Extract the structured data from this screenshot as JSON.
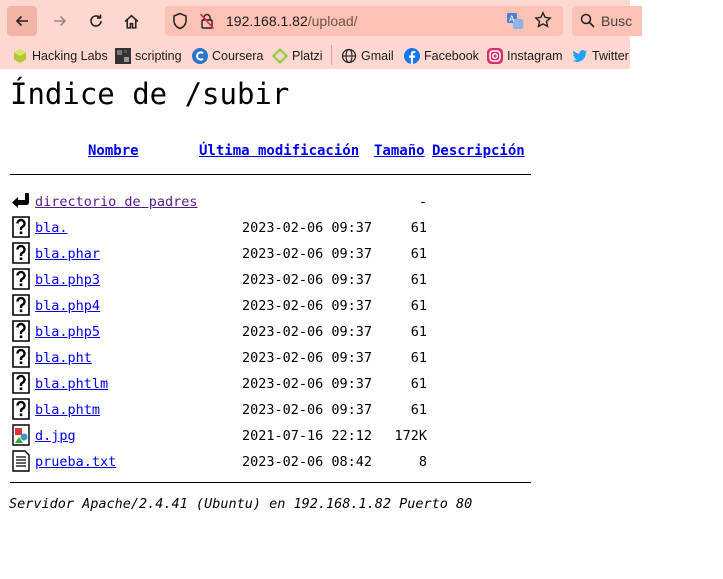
{
  "browser": {
    "url_host": "192.168.1.82",
    "url_path": "/upload/",
    "search_placeholder": "Busc",
    "bookmarks": [
      {
        "label": "Hacking Labs",
        "icon": "hacking-labs-icon"
      },
      {
        "label": "scripting",
        "icon": "scripting-icon"
      },
      {
        "label": "Coursera",
        "icon": "coursera-icon"
      },
      {
        "label": "Platzi",
        "icon": "platzi-icon"
      },
      {
        "label": "Gmail",
        "icon": "globe-icon"
      },
      {
        "label": "Facebook",
        "icon": "facebook-icon"
      },
      {
        "label": "Instagram",
        "icon": "instagram-icon"
      },
      {
        "label": "Twitter",
        "icon": "twitter-icon"
      }
    ]
  },
  "listing": {
    "title": "Índice de /subir",
    "headers": {
      "name": "Nombre",
      "modified": "Última modificación",
      "size": "Tamaño",
      "description": "Descripción"
    },
    "parent": {
      "name": "directorio de padres",
      "size": "-"
    },
    "files": [
      {
        "name": "bla.",
        "date": "2023-02-06 09:37",
        "size": "61",
        "type": "unknown"
      },
      {
        "name": "bla.phar",
        "date": "2023-02-06 09:37",
        "size": "61",
        "type": "unknown"
      },
      {
        "name": "bla.php3",
        "date": "2023-02-06 09:37",
        "size": "61",
        "type": "unknown"
      },
      {
        "name": "bla.php4",
        "date": "2023-02-06 09:37",
        "size": "61",
        "type": "unknown"
      },
      {
        "name": "bla.php5",
        "date": "2023-02-06 09:37",
        "size": "61",
        "type": "unknown"
      },
      {
        "name": "bla.pht",
        "date": "2023-02-06 09:37",
        "size": "61",
        "type": "unknown"
      },
      {
        "name": "bla.phtlm",
        "date": "2023-02-06 09:37",
        "size": "61",
        "type": "unknown"
      },
      {
        "name": "bla.phtm",
        "date": "2023-02-06 09:37",
        "size": "61",
        "type": "unknown"
      },
      {
        "name": "d.jpg",
        "date": "2021-07-16 22:12",
        "size": "172K",
        "type": "image"
      },
      {
        "name": "prueba.txt",
        "date": "2023-02-06 08:42",
        "size": "8",
        "type": "text"
      }
    ],
    "footer": "Servidor Apache/2.4.41 (Ubuntu) en 192.168.1.82 Puerto 80"
  },
  "colors": {
    "chrome_bg": "#fdd7d0",
    "link": "#0000ee",
    "visited": "#551a8b"
  }
}
